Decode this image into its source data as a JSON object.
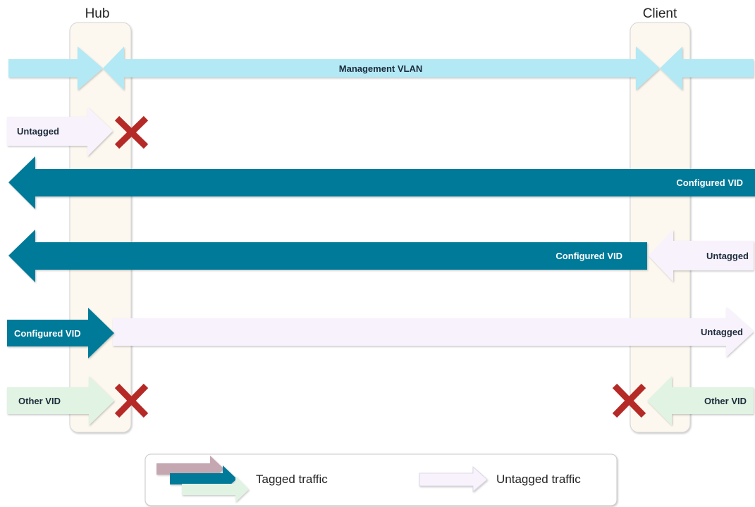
{
  "columns": {
    "hub": "Hub",
    "client": "Client"
  },
  "rows": {
    "management": "Management VLAN",
    "untagged_dropped": "Untagged",
    "configured_vid_full": "Configured VID",
    "configured_vid_partial": "Configured VID",
    "untagged_from_client": "Untagged",
    "configured_vid_from_hub": "Configured VID",
    "untagged_to_client": "Untagged",
    "other_vid_hub": "Other VID",
    "other_vid_client": "Other VID"
  },
  "legend": {
    "tagged": "Tagged traffic",
    "untagged": "Untagged traffic"
  },
  "colors": {
    "management": "#b3e8f5",
    "configured_vid": "#007a99",
    "untagged": "#f8f2fd",
    "other_vid": "#e1f3e3",
    "tagged_mauve": "#c5a7b2",
    "column_band": "#fcf8ef",
    "drop_mark": "#b52a26"
  }
}
